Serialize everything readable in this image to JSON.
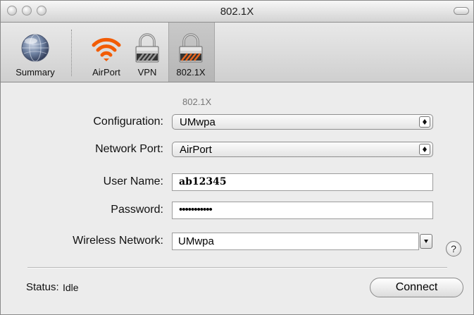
{
  "window": {
    "title": "802.1X"
  },
  "toolbar": {
    "items": [
      {
        "label": "Summary",
        "icon": "globe-icon"
      },
      {
        "label": "AirPort",
        "icon": "airport-wifi-icon"
      },
      {
        "label": "VPN",
        "icon": "lock-icon"
      },
      {
        "label": "802.1X",
        "icon": "lock-icon",
        "selected": true
      }
    ]
  },
  "form": {
    "section_label": "802.1X",
    "configuration": {
      "label": "Configuration:",
      "value": "UMwpa"
    },
    "network_port": {
      "label": "Network Port:",
      "value": "AirPort"
    },
    "user_name": {
      "label": "User Name:",
      "value": "ab12345"
    },
    "password": {
      "label": "Password:",
      "value": "•••••••••••"
    },
    "wireless_network": {
      "label": "Wireless Network:",
      "value": "UMwpa"
    },
    "help_label": "?"
  },
  "status": {
    "label": "Status:",
    "value": "Idle"
  },
  "connect_label": "Connect",
  "colors": {
    "airport_orange": "#f25c05",
    "lock_stripe_orange": "#e9661f",
    "lock_stripe_dark": "#333333"
  }
}
